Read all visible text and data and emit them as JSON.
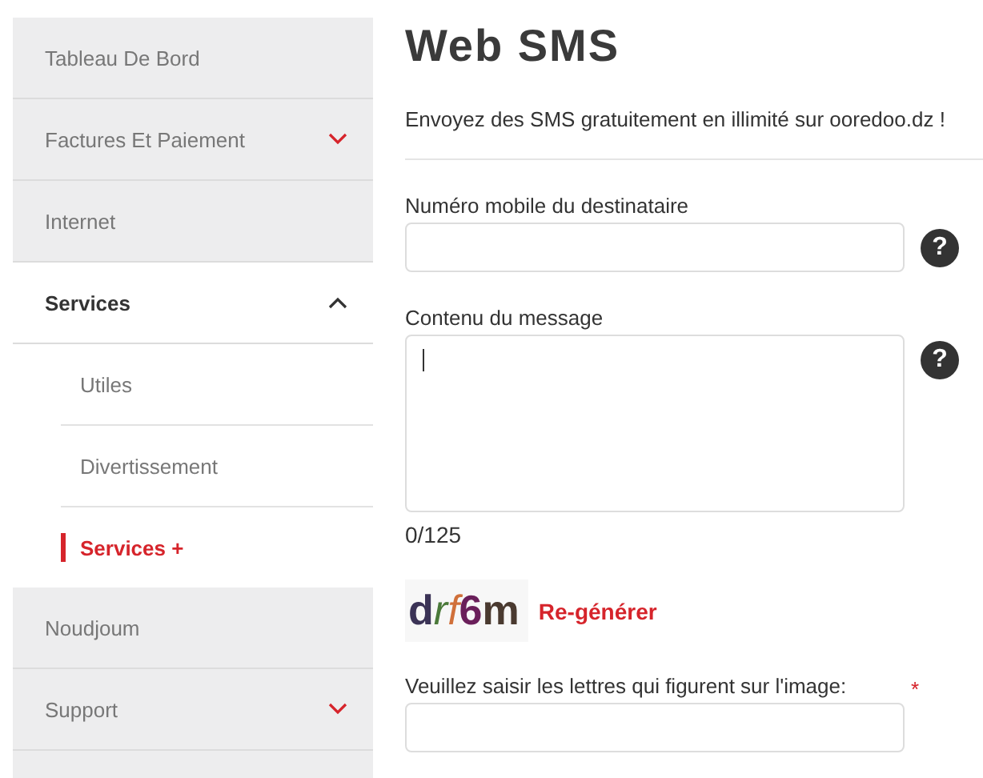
{
  "sidebar": {
    "items": [
      {
        "label": "Tableau De Bord",
        "kind": "link",
        "selected": false,
        "expanded": false
      },
      {
        "label": "Factures Et Paiement",
        "kind": "group",
        "selected": false,
        "expanded": false
      },
      {
        "label": "Internet",
        "kind": "link",
        "selected": false,
        "expanded": false
      },
      {
        "label": "Services",
        "kind": "group",
        "selected": true,
        "expanded": true,
        "children": [
          {
            "label": "Utiles",
            "selected": false
          },
          {
            "label": "Divertissement",
            "selected": false
          },
          {
            "label": "Services +",
            "selected": true
          }
        ]
      },
      {
        "label": "Noudjoum",
        "kind": "link",
        "selected": false,
        "expanded": false
      },
      {
        "label": "Support",
        "kind": "group",
        "selected": false,
        "expanded": false
      }
    ]
  },
  "page": {
    "title": "Web SMS",
    "subtitle": "Envoyez des SMS gratuitement en illimité sur ooredoo.dz !"
  },
  "form": {
    "fields": [
      {
        "label": "Numéro mobile du destinataire",
        "kind": "input",
        "help": "?",
        "focused": false
      },
      {
        "label": "Contenu du message",
        "kind": "textarea",
        "help": "?",
        "focused": true,
        "counter": "0/125"
      }
    ],
    "captcha": {
      "code": "drf6m",
      "regenerate": "Re-générer"
    },
    "captcha_field": {
      "label": "Veuillez saisir les lettres qui figurent sur l'image:",
      "required_mark": "*"
    }
  }
}
